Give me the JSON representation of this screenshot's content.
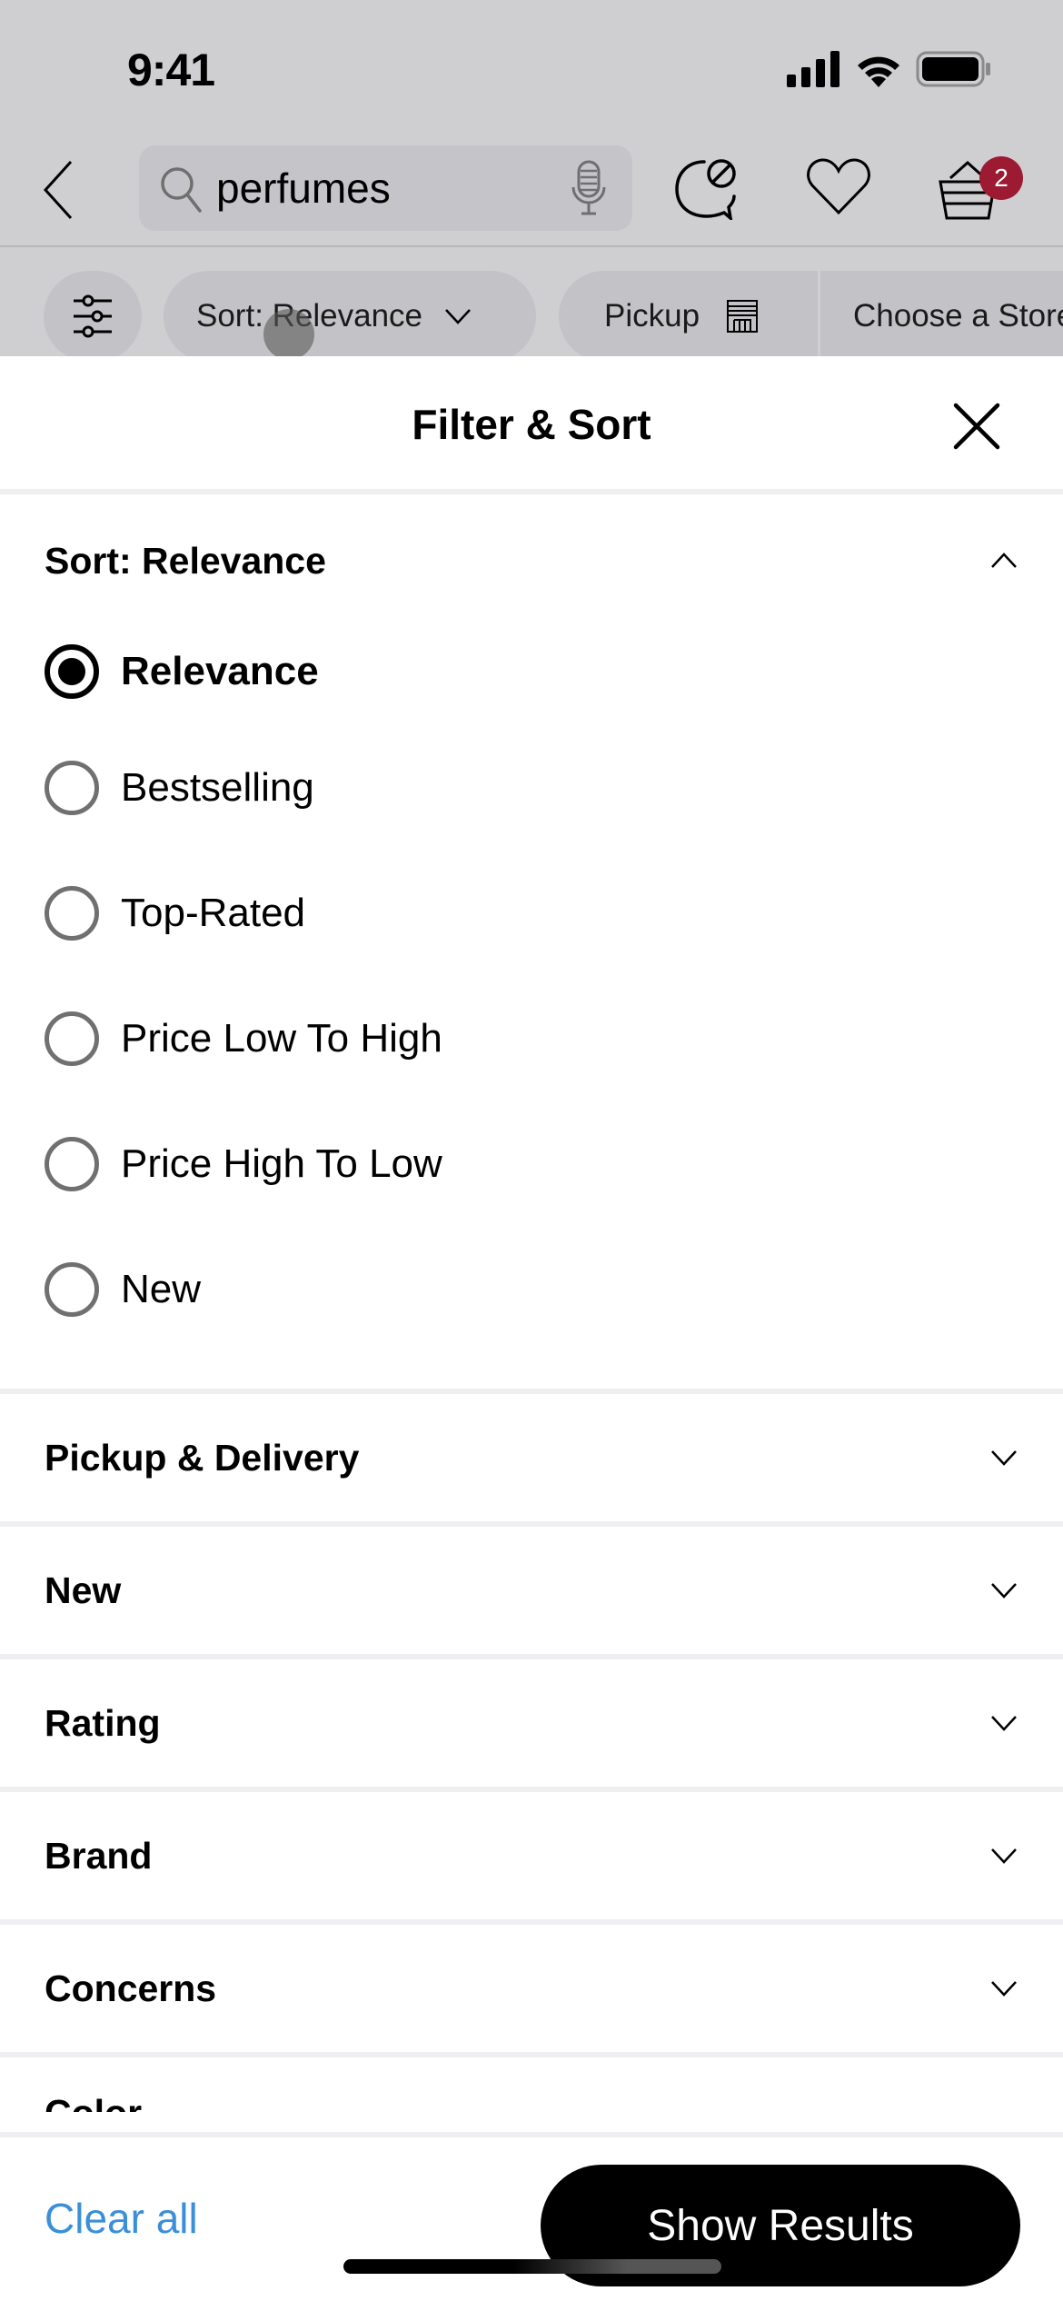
{
  "status_bar": {
    "time": "9:41"
  },
  "nav": {
    "search_value": "perfumes",
    "cart_count": "2",
    "badge_color": "#9c1a32"
  },
  "chips": {
    "sort_label": "Sort: Relevance",
    "pickup_label": "Pickup",
    "store_label": "Choose a Store"
  },
  "sheet": {
    "title": "Filter & Sort",
    "sort_section": {
      "title": "Sort: Relevance",
      "options": [
        {
          "label": "Relevance",
          "selected": true
        },
        {
          "label": "Bestselling",
          "selected": false
        },
        {
          "label": "Top-Rated",
          "selected": false
        },
        {
          "label": "Price Low To High",
          "selected": false
        },
        {
          "label": "Price High To Low",
          "selected": false
        },
        {
          "label": "New",
          "selected": false
        }
      ]
    },
    "sections": [
      {
        "title": "Pickup & Delivery"
      },
      {
        "title": "New"
      },
      {
        "title": "Rating"
      },
      {
        "title": "Brand"
      },
      {
        "title": "Concerns"
      }
    ],
    "partial_section": "Color"
  },
  "footer": {
    "clear_all": "Clear all",
    "show_results": "Show Results",
    "link_color": "#3a8fd8"
  }
}
